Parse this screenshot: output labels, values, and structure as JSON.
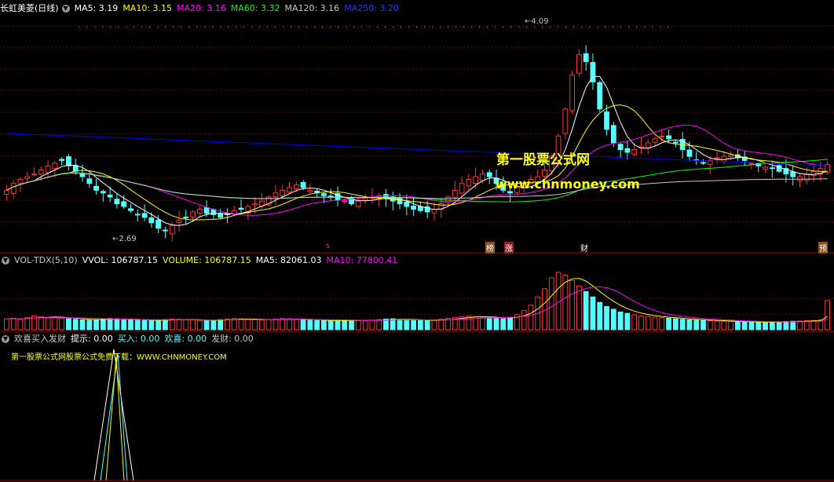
{
  "price_panel": {
    "title": "长虹美菱(日线)",
    "ma5": "MA5: 3.19",
    "ma10": "MA10: 3.15",
    "ma20": "MA20: 3.16",
    "ma60": "MA60: 3.32",
    "ma120": "MA120: 3.16",
    "ma250": "MA250: 3.20",
    "high_label": "4.09",
    "low_label": "2.69",
    "events": [
      {
        "label": "s",
        "color": "#ff3030"
      },
      {
        "label": "榜",
        "color": "#ffffff",
        "bg": "#a06030"
      },
      {
        "label": "涨",
        "color": "#ffffff",
        "bg": "#a03030"
      },
      {
        "label": "财",
        "color": "#ffffff"
      },
      {
        "label": "预",
        "color": "#ffffff",
        "bg": "#a06030"
      }
    ],
    "watermark_title": "第一股票公式网",
    "watermark_url": "www.chnmoney.com"
  },
  "volume_panel": {
    "name": "VOL-TDX(5,10)",
    "vvol": "VVOL: 106787.15",
    "volume": "VOLUME: 106787.15",
    "ma5": "MA5: 82061.03",
    "ma10": "MA10: 77800.41"
  },
  "indicator_panel": {
    "name": "欢喜买入发财",
    "hint": "提示: 0.00",
    "buy": "买入: 0.00",
    "joy": "欢喜: 0.00",
    "fortune": "发财: 0.00",
    "promo": "第一股票公式网股票公式免费下载：WWW.CHNMONEY.COM"
  },
  "colors": {
    "up": "#ff3232",
    "down": "#54ffff",
    "ma5": "#ffffff",
    "ma10": "#ffff00",
    "ma20": "#ff00ff",
    "ma60": "#00ff00",
    "ma120": "#c8c8c8",
    "ma250": "#0000ff",
    "grid": "#6a0000",
    "vvol": "#ffffff",
    "volume": "#ffff00",
    "vol_ma5": "#ff00ff",
    "vol_ma10": "#ff00ff"
  },
  "chart_data": {
    "type": "candlestick",
    "price_range": [
      2.55,
      4.3
    ],
    "high": 4.09,
    "low": 2.69,
    "closes": [
      3.0,
      3.05,
      3.08,
      3.1,
      3.12,
      3.15,
      3.18,
      3.2,
      3.22,
      3.18,
      3.14,
      3.1,
      3.05,
      3.0,
      2.98,
      2.95,
      2.9,
      2.88,
      2.85,
      2.82,
      2.8,
      2.76,
      2.72,
      2.7,
      2.74,
      2.78,
      2.8,
      2.84,
      2.86,
      2.83,
      2.82,
      2.8,
      2.82,
      2.85,
      2.86,
      2.88,
      2.9,
      2.92,
      2.95,
      2.98,
      3.0,
      3.02,
      3.04,
      3.02,
      3.0,
      2.98,
      2.96,
      2.95,
      2.93,
      2.92,
      2.9,
      2.92,
      2.94,
      2.95,
      2.96,
      2.94,
      2.92,
      2.9,
      2.88,
      2.86,
      2.85,
      2.84,
      2.86,
      2.9,
      2.95,
      3.0,
      3.05,
      3.08,
      3.1,
      3.12,
      3.1,
      3.05,
      3.0,
      2.98,
      3.02,
      3.05,
      3.08,
      3.1,
      3.15,
      3.25,
      3.4,
      3.6,
      3.85,
      4.0,
      3.95,
      3.8,
      3.6,
      3.45,
      3.35,
      3.3,
      3.28,
      3.3,
      3.32,
      3.35,
      3.38,
      3.4,
      3.38,
      3.35,
      3.3,
      3.25,
      3.22,
      3.2,
      3.22,
      3.24,
      3.25,
      3.26,
      3.24,
      3.22,
      3.2,
      3.18,
      3.17,
      3.16,
      3.14,
      3.12,
      3.1,
      3.1,
      3.12,
      3.14,
      3.16,
      3.19
    ],
    "volume_range": [
      0,
      230000
    ],
    "volumes": [
      40000,
      42000,
      38000,
      45000,
      50000,
      48000,
      44000,
      46000,
      42000,
      40000,
      38000,
      36000,
      35000,
      37000,
      39000,
      41000,
      40000,
      38000,
      36000,
      35000,
      34000,
      33000,
      35000,
      37000,
      39000,
      38000,
      36000,
      35000,
      34000,
      33000,
      35000,
      37000,
      39000,
      41000,
      40000,
      38000,
      36000,
      35000,
      37000,
      39000,
      41000,
      40000,
      38000,
      36000,
      35000,
      34000,
      33000,
      32000,
      34000,
      36000,
      35000,
      34000,
      33000,
      35000,
      37000,
      39000,
      40000,
      38000,
      36000,
      35000,
      34000,
      33000,
      35000,
      38000,
      42000,
      45000,
      48000,
      50000,
      48000,
      46000,
      44000,
      42000,
      40000,
      45000,
      55000,
      70000,
      90000,
      120000,
      150000,
      190000,
      210000,
      200000,
      180000,
      160000,
      140000,
      120000,
      100000,
      85000,
      75000,
      65000,
      60000,
      55000,
      50000,
      48000,
      46000,
      44000,
      42000,
      40000,
      38000,
      36000,
      35000,
      34000,
      33000,
      32000,
      31000,
      30000,
      29000,
      28000,
      28000,
      27000,
      27000,
      28000,
      29000,
      30000,
      31000,
      32000,
      33000,
      34000,
      36000,
      106787
    ]
  }
}
